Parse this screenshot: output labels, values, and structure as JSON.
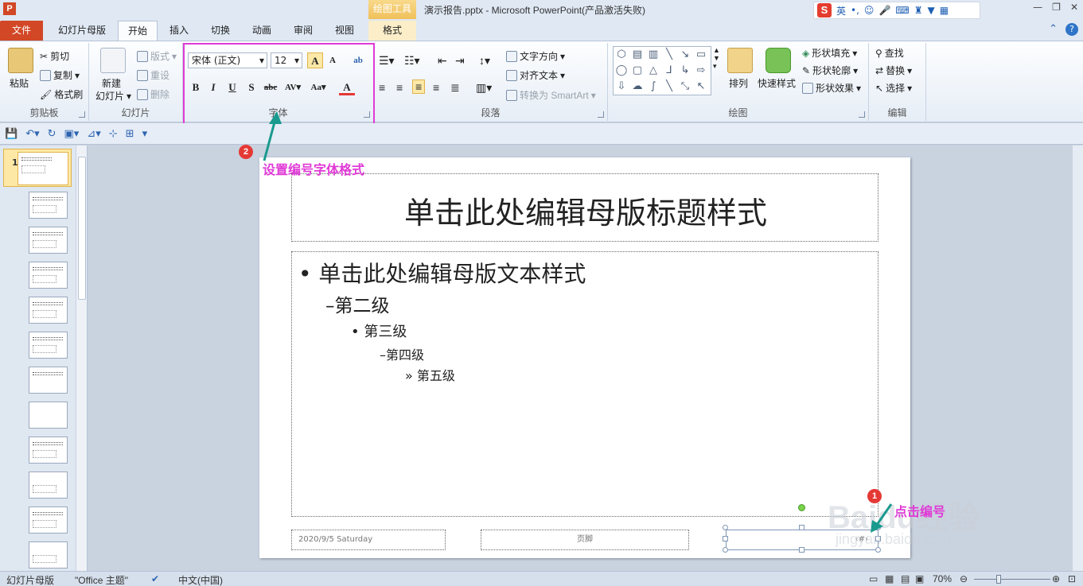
{
  "window": {
    "title": "演示报告.pptx - Microsoft PowerPoint(产品激活失败)",
    "context_tool": "绘图工具",
    "app_icon_letter": "P"
  },
  "ime": {
    "mode": "英",
    "logo": "S"
  },
  "tabs": {
    "file": "文件",
    "items": [
      "幻灯片母版",
      "开始",
      "插入",
      "切换",
      "动画",
      "审阅",
      "视图",
      "格式"
    ]
  },
  "ribbon": {
    "clipboard": {
      "label": "剪贴板",
      "paste": "粘贴",
      "cut": "剪切",
      "copy": "复制",
      "format_painter": "格式刷"
    },
    "slides": {
      "label": "幻灯片",
      "new_slide": "新建",
      "new_slide2": "幻灯片",
      "layout": "版式",
      "reset": "重设",
      "delete": "删除"
    },
    "font": {
      "label": "字体",
      "font_name": "宋体 (正文)",
      "font_size": "12"
    },
    "paragraph": {
      "label": "段落",
      "text_direction": "文字方向",
      "align_text": "对齐文本",
      "smartart": "转换为 SmartArt"
    },
    "drawing": {
      "label": "绘图",
      "arrange": "排列",
      "quick_styles": "快速样式",
      "shape_fill": "形状填充",
      "shape_outline": "形状轮廓",
      "shape_effects": "形状效果"
    },
    "editing": {
      "label": "编辑",
      "find": "查找",
      "replace": "替换",
      "select": "选择"
    }
  },
  "slide": {
    "title": "单击此处编辑母版标题样式",
    "levels": [
      "单击此处编辑母版文本样式",
      "第二级",
      "第三级",
      "第四级",
      "第五级"
    ],
    "bullets": [
      "•",
      "–",
      "•",
      "–",
      "»"
    ],
    "date": "2020/9/5 Saturday",
    "footer": "页脚",
    "slide_number": "‹#›"
  },
  "annotations": {
    "step1_badge": "1",
    "step1_text": "点击编号",
    "step2_badge": "2",
    "step2_text": "设置编号字体格式",
    "highlight_color": "#e03ad6"
  },
  "thumbnails": {
    "master_number": "1",
    "count": 12
  },
  "watermark": {
    "text": "Baidu经验",
    "url": "jingyan.baidu.com"
  },
  "statusbar": {
    "view": "幻灯片母版",
    "theme": "\"Office 主题\"",
    "language": "中文(中国)",
    "zoom": "70%"
  }
}
